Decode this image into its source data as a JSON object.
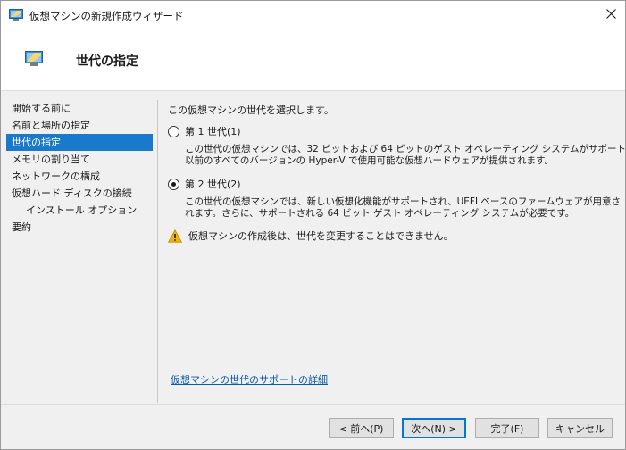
{
  "window": {
    "title": "仮想マシンの新規作成ウィザード",
    "icon": "hyperv-vm-icon",
    "close_icon": "close-icon"
  },
  "header": {
    "title": "世代の指定",
    "icon": "hyperv-vm-icon"
  },
  "nav": {
    "items": [
      {
        "label": "開始する前に",
        "selected": false,
        "sub": false
      },
      {
        "label": "名前と場所の指定",
        "selected": false,
        "sub": false
      },
      {
        "label": "世代の指定",
        "selected": true,
        "sub": false
      },
      {
        "label": "メモリの割り当て",
        "selected": false,
        "sub": false
      },
      {
        "label": "ネットワークの構成",
        "selected": false,
        "sub": false
      },
      {
        "label": "仮想ハード ディスクの接続",
        "selected": false,
        "sub": false
      },
      {
        "label": "インストール オプション",
        "selected": false,
        "sub": true
      },
      {
        "label": "要約",
        "selected": false,
        "sub": false
      }
    ]
  },
  "main": {
    "instruction": "この仮想マシンの世代を選択します。",
    "options": [
      {
        "label": "第 1 世代(1)",
        "checked": false,
        "description": [
          "この世代の仮想マシンでは、32 ビットおよび 64 ビットのゲスト オペレーティング システムがサポートされ、",
          "以前のすべてのバージョンの Hyper-V で使用可能な仮想ハードウェアが提供されます。"
        ]
      },
      {
        "label": "第 2 世代(2)",
        "checked": true,
        "description": [
          "この世代の仮想マシンでは、新しい仮想化機能がサポートされ、UEFI ベースのファームウェアが用意さ",
          "れます。さらに、サポートされる 64 ビット ゲスト オペレーティング システムが必要です。"
        ]
      }
    ],
    "warning": "仮想マシンの作成後は、世代を変更することはできません。",
    "warning_icon": "warning-icon",
    "help_link": "仮想マシンの世代のサポートの詳細"
  },
  "buttons": {
    "prev": "< 前へ(P)",
    "next": "次へ(N) >",
    "finish": "完了(F)",
    "cancel": "キャンセル"
  },
  "colors": {
    "selection": "#1979ca",
    "link": "#0b5aa8",
    "default_button_border": "#0078d7",
    "warning": "#f2b600"
  }
}
